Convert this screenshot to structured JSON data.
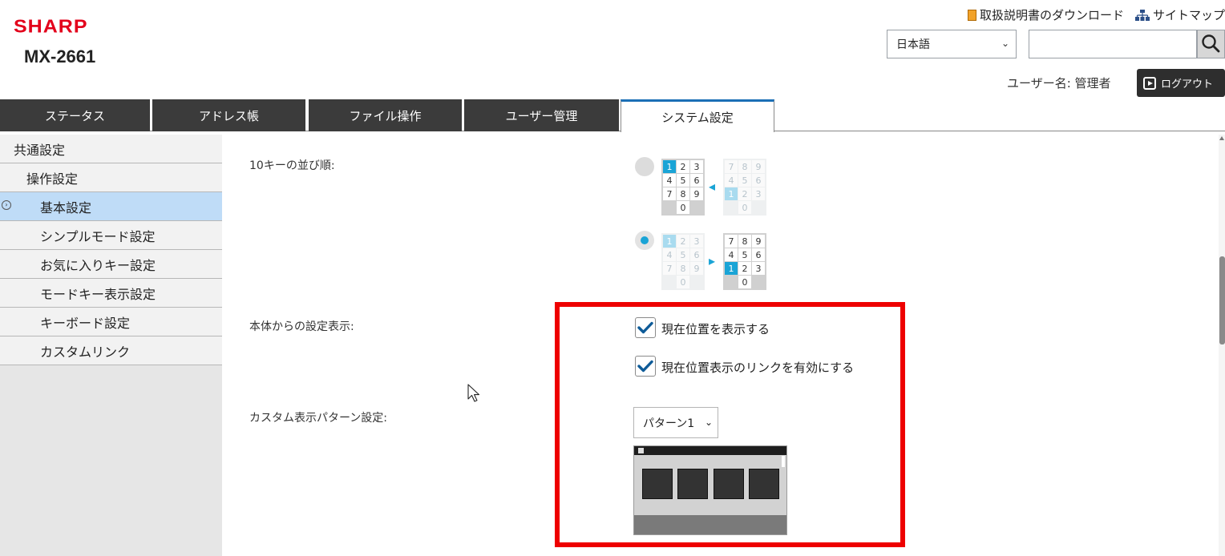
{
  "header": {
    "brand": "SHARP",
    "model": "MX-2661",
    "manual_link": "取扱説明書のダウンロード",
    "sitemap_link": "サイトマップ",
    "language": "日本語",
    "search_placeholder": "",
    "username_label": "ユーザー名: 管理者",
    "logout_label": "ログアウト"
  },
  "tabs": [
    {
      "label": "ステータス"
    },
    {
      "label": "アドレス帳"
    },
    {
      "label": "ファイル操作"
    },
    {
      "label": "ユーザー管理"
    },
    {
      "label": "システム設定"
    }
  ],
  "sidebar": {
    "items": [
      {
        "label": "共通設定"
      },
      {
        "label": "操作設定"
      },
      {
        "label": "基本設定"
      },
      {
        "label": "シンプルモード設定"
      },
      {
        "label": "お気に入りキー設定"
      },
      {
        "label": "モードキー表示設定"
      },
      {
        "label": "キーボード設定"
      },
      {
        "label": "カスタムリンク"
      }
    ]
  },
  "content": {
    "tenkey_label": "10キーの並び順:",
    "keypad_keys_a": [
      "1",
      "2",
      "3",
      "4",
      "5",
      "6",
      "7",
      "8",
      "9",
      "0"
    ],
    "keypad_keys_b": [
      "7",
      "8",
      "9",
      "4",
      "5",
      "6",
      "1",
      "2",
      "3",
      "0"
    ],
    "setting_display_label": "本体からの設定表示:",
    "show_position": "現在位置を表示する",
    "enable_position_link": "現在位置表示のリンクを有効にする",
    "custom_pattern_label": "カスタム表示パターン設定:",
    "pattern_value": "パターン1"
  },
  "colors": {
    "brand_red": "#e3001b",
    "accent_blue": "#1aa4d6",
    "highlight_red": "#ee0000",
    "tab_active_border": "#1b6fb6"
  }
}
